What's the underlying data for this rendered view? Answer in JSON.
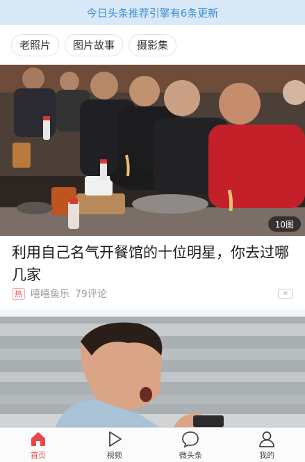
{
  "banner": {
    "text": "今日头条推荐引擎有6条更新"
  },
  "chips": [
    "老照片",
    "图片故事",
    "摄影集"
  ],
  "article1": {
    "photo_count": "10图",
    "title": "利用自己名气开餐馆的十位明星，你去过哪几家",
    "hot_badge": "热",
    "source": "嘻嘻鱼乐",
    "comments": "79评论",
    "close_label": "✕"
  },
  "tabbar": {
    "items": [
      {
        "label": "首页",
        "icon": "home-icon",
        "active": true
      },
      {
        "label": "视频",
        "icon": "play-icon",
        "active": false
      },
      {
        "label": "微头条",
        "icon": "chat-bubble-icon",
        "active": false
      },
      {
        "label": "我的",
        "icon": "person-icon",
        "active": false
      }
    ]
  },
  "colors": {
    "accent": "#e8474b",
    "banner_text": "#3d8fd6",
    "banner_bg": "#d9e9f8"
  }
}
